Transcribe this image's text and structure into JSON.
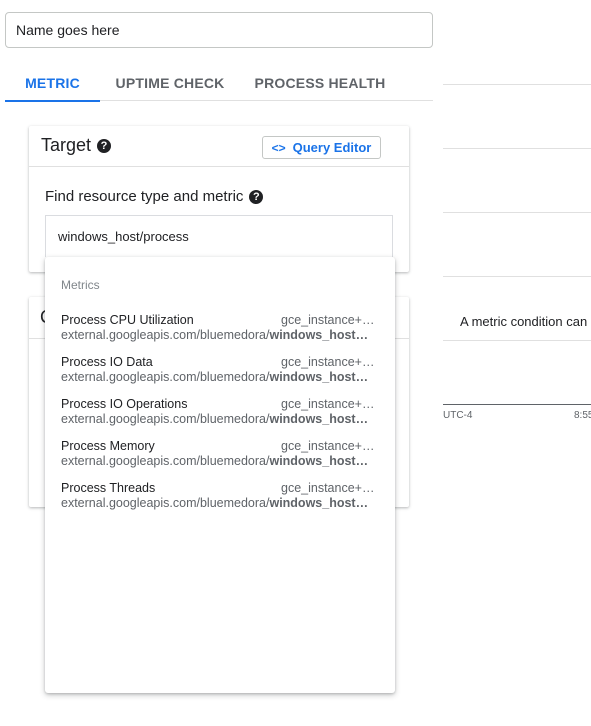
{
  "name_field": {
    "value": "Name goes here"
  },
  "tabs": [
    {
      "label": "METRIC",
      "active": true
    },
    {
      "label": "UPTIME CHECK",
      "active": false
    },
    {
      "label": "PROCESS HEALTH",
      "active": false
    }
  ],
  "target": {
    "title": "Target",
    "help_icon": "help-circle-icon",
    "query_editor_label": "Query Editor",
    "query_editor_icon": "code-icon",
    "find_label": "Find resource type and metric",
    "resource_value": "windows_host/process"
  },
  "second_card_peek": "C",
  "dropdown": {
    "header": "Metrics",
    "items": [
      {
        "name": "Process CPU Utilization",
        "type": "gce_instance+…",
        "path_prefix": "external.googleapis.com/bluemedora/",
        "path_bold": "windows_host…"
      },
      {
        "name": "Process IO Data",
        "type": "gce_instance+…",
        "path_prefix": "external.googleapis.com/bluemedora/",
        "path_bold": "windows_host…"
      },
      {
        "name": "Process IO Operations",
        "type": "gce_instance+…",
        "path_prefix": "external.googleapis.com/bluemedora/",
        "path_bold": "windows_host…"
      },
      {
        "name": "Process Memory",
        "type": "gce_instance+…",
        "path_prefix": "external.googleapis.com/bluemedora/",
        "path_bold": "windows_host…"
      },
      {
        "name": "Process Threads",
        "type": "gce_instance+…",
        "path_prefix": "external.googleapis.com/bluemedora/",
        "path_bold": "windows_host…"
      }
    ]
  },
  "preview": {
    "message": "A metric condition can",
    "axis_left": "UTC-4",
    "axis_right": "8:55"
  },
  "colors": {
    "accent": "#1a73e8",
    "text": "#202124",
    "muted": "#5f6368"
  }
}
